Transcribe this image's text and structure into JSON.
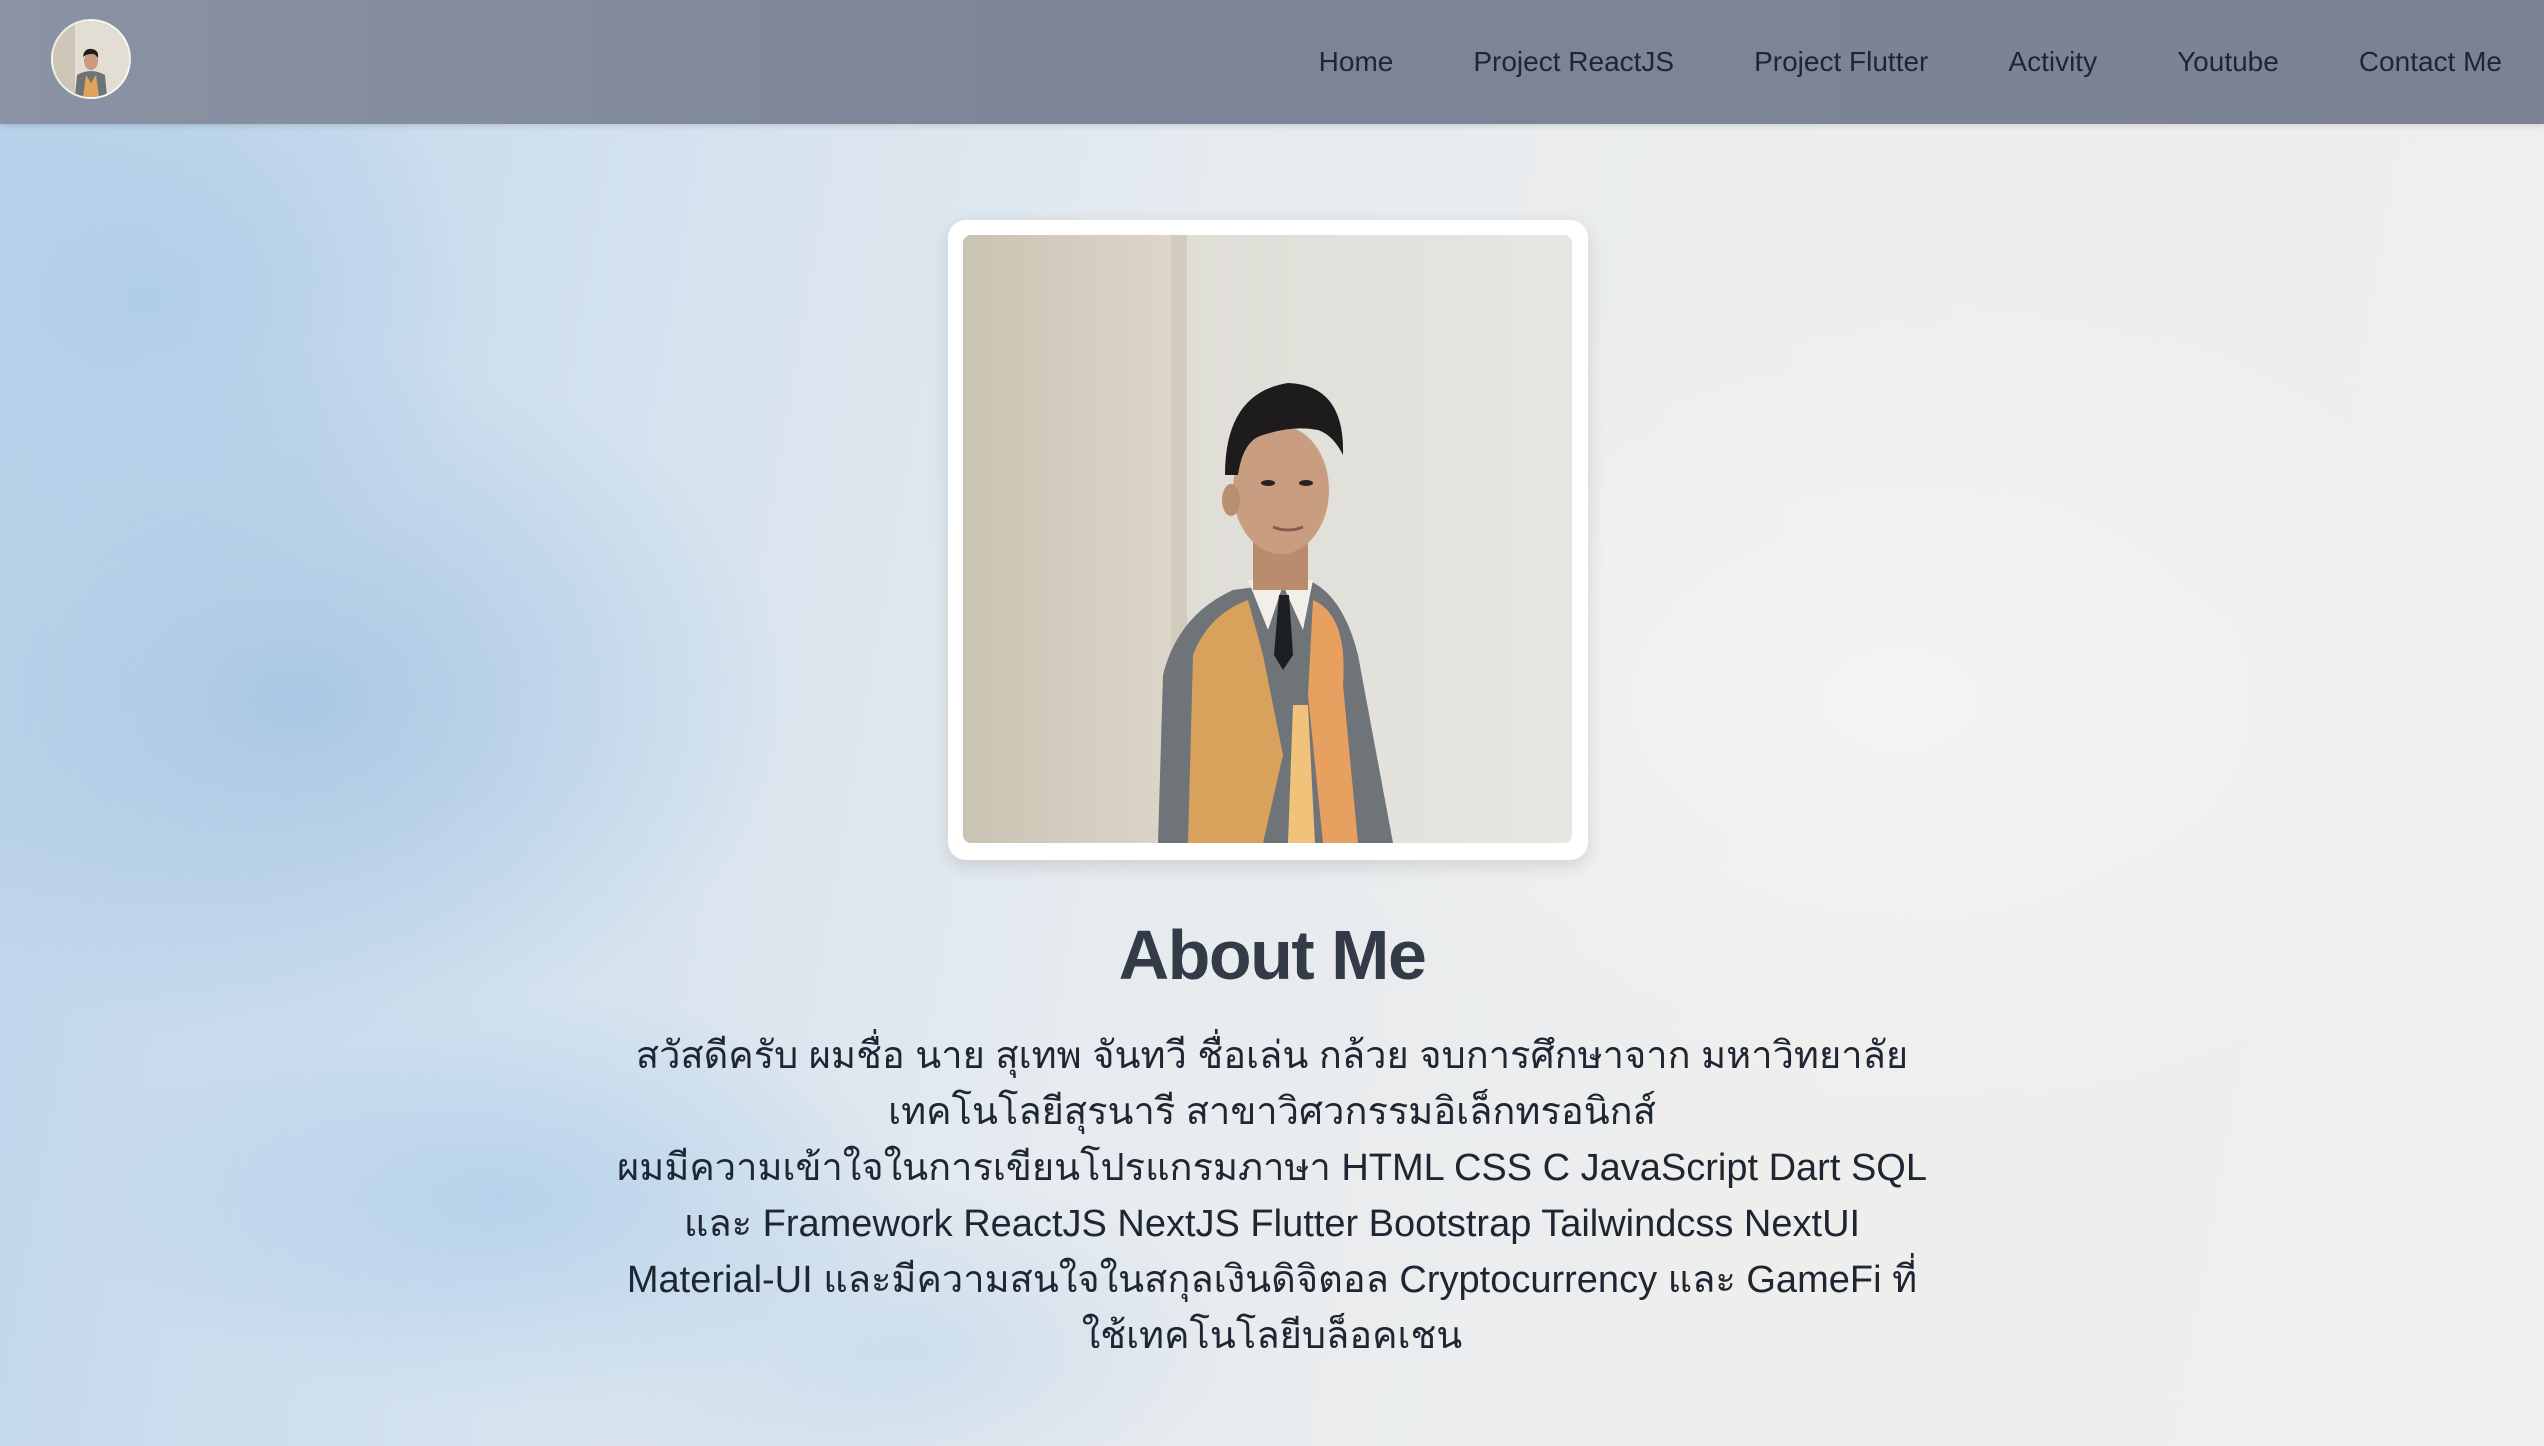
{
  "nav": {
    "items": [
      {
        "label": "Home"
      },
      {
        "label": "Project ReactJS"
      },
      {
        "label": "Project Flutter"
      },
      {
        "label": "Activity"
      },
      {
        "label": "Youtube"
      },
      {
        "label": "Contact Me"
      }
    ]
  },
  "about": {
    "title": "About Me",
    "paragraph_lines": [
      "สวัสดีครับ ผมชื่อ นาย สุเทพ จันทวี ชื่อเล่น กล้วย จบการศึกษาจาก มหาวิทยาลัย",
      "เทคโนโลยีสุรนารี สาขาวิศวกรรมอิเล็กทรอนิกส์",
      "ผมมีความเข้าใจในการเขียนโปรแกรมภาษา HTML CSS C JavaScript Dart SQL",
      "และ Framework ReactJS NextJS Flutter Bootstrap Tailwindcss NextUI",
      "Material-UI และมีความสนใจในสกุลเงินดิจิตอล Cryptocurrency และ GameFi ที่",
      "ใช้เทคโนโลยีบล็อคเชน"
    ]
  },
  "colors": {
    "navbar": "#7d8698",
    "nav_text": "#1f2633",
    "title_text": "#343b48",
    "body_text": "#1f2633",
    "photo_frame": "#ffffff"
  }
}
